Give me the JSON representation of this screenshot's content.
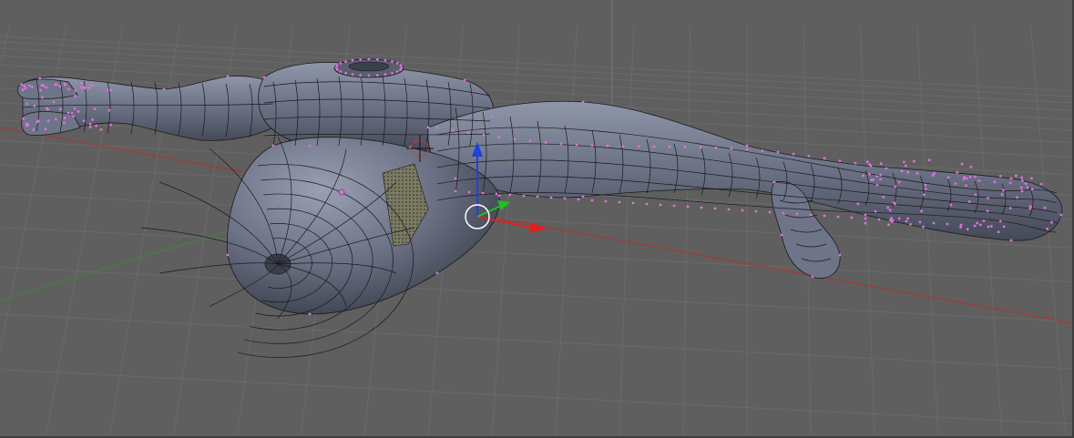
{
  "viewport": {
    "background": "#5f5f5f",
    "grid_color": "#6a6a6a",
    "grid_major_color": "#737373",
    "axis_x_color": "#b43030",
    "axis_y_color": "#3a8a3a",
    "mesh_fill": "#6b7184",
    "mesh_shadow": "#4a4f5e",
    "mesh_highlight": "#8e95a8",
    "wire_color": "#1a1a1a",
    "vertex_color": "#e070e0",
    "selected_face_color": "#8c8c6a"
  },
  "widget": {
    "x_arrow_color": "#e02020",
    "y_arrow_color": "#20c020",
    "z_arrow_color": "#2040e0",
    "pivot_ring_color": "#ffffff",
    "cursor_color": "#e03030"
  },
  "icons": {
    "transform_manipulator": "transform-manipulator-icon",
    "pivot": "pivot-circle-icon",
    "cursor3d": "3d-cursor-icon"
  }
}
